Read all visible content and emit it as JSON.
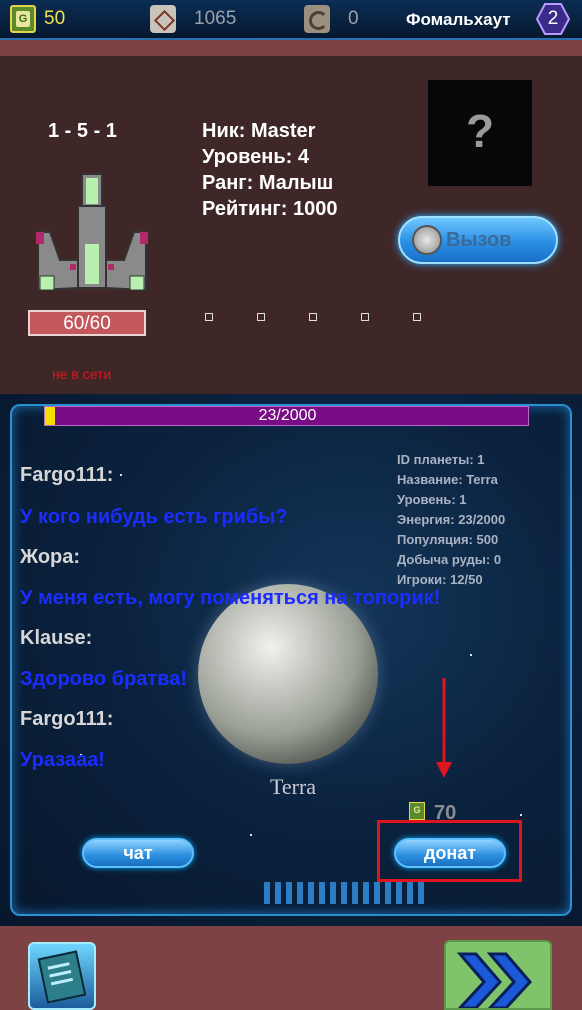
{
  "top_bar": {
    "coins": "50",
    "crystals": "1065",
    "spirals": "0",
    "planet_name": "Фомальхаут",
    "sector_number": "2"
  },
  "player": {
    "coordinates": "1 - 5 - 1",
    "hp": "60/60",
    "status": "не в сети",
    "nick": "Ник: Master",
    "level": "Уровень: 4",
    "rank": "Ранг: Малыш",
    "rating": "Рейтинг: 1000",
    "avatar_placeholder": "?",
    "challenge_button": "Вызов"
  },
  "planet": {
    "progress_text": "23/2000",
    "progress_fraction": 0.0115,
    "label": "Terra",
    "info": [
      "ID планеты: 1",
      "Название: Terra",
      "Уровень: 1",
      "Энергия: 23/2000",
      "Популяция: 500",
      "Добыча руды: 0",
      "Игроки: 12/50"
    ],
    "chat": [
      {
        "name": "Fargo111:",
        "message": "У кого нибудь есть грибы?"
      },
      {
        "name": "Жора:",
        "message": "У меня есть, могу поменяться на топорик!"
      },
      {
        "name": "Klause:",
        "message": "Здорово братва!"
      },
      {
        "name": "Fargo111:",
        "message": "Уразааа!"
      }
    ],
    "donate_cost": "70",
    "chat_button": "чат",
    "donate_button": "донат"
  },
  "colors": {
    "accent_brown": "#7d4344",
    "chat_message": "#1a2cff",
    "progress_fill": "#7a0b86",
    "annotation_red": "#e0141c"
  }
}
